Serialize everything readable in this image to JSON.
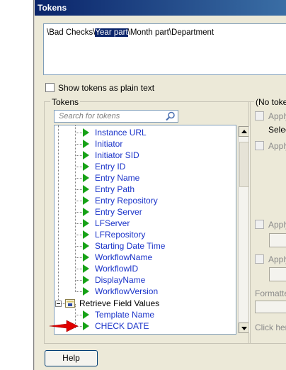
{
  "window": {
    "title": "Tokens"
  },
  "token_path": {
    "before": "\\Bad Checks\\",
    "selected": "Year part",
    "after": "\\Month part\\Department"
  },
  "options": {
    "plain_text_label": "Show tokens as plain text"
  },
  "tokens_group": {
    "title": "Tokens",
    "search_placeholder": "Search for tokens",
    "items": [
      "Instance URL",
      "Initiator",
      "Initiator SID",
      "Entry ID",
      "Entry Name",
      "Entry Path",
      "Entry Repository",
      "Entry Server",
      "LFServer",
      "LFRepository",
      "Starting Date Time",
      "WorkflowName",
      "WorkflowID",
      "DisplayName",
      "WorkflowVersion"
    ],
    "folder_label": "Retrieve Field Values",
    "folder_items": [
      "Template Name",
      "CHECK DATE"
    ]
  },
  "right_panel": {
    "title": "(No toker",
    "apply_1": "Apply",
    "select": "Selec",
    "apply_2": "Apply",
    "apply_3": "Apply",
    "apply_4": "Apply",
    "formatted": "Formatted",
    "click_here": "Click here"
  },
  "help_label": "Help",
  "colors": {
    "token_text": "#1a33c9",
    "token_icon": "#17a217",
    "titlebar": "#0a246a",
    "arrow": "#e00000"
  }
}
